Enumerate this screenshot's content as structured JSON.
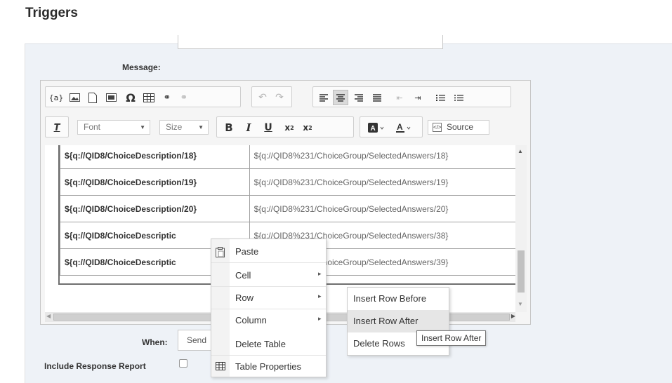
{
  "page": {
    "title": "Triggers"
  },
  "form": {
    "message_label": "Message:",
    "when_label": "When:",
    "when_value": "Send",
    "include_label": "Include Response Report"
  },
  "toolbar": {
    "font_label": "Font",
    "size_label": "Size",
    "source_label": "Source",
    "placeholder_btn": "{a}",
    "bold": "B",
    "italic": "I",
    "underline": "U"
  },
  "table": {
    "rows": [
      {
        "left": "${q://QID8/ChoiceDescription/18}",
        "right": "${q://QID8%231/ChoiceGroup/SelectedAnswers/18}"
      },
      {
        "left": "${q://QID8/ChoiceDescription/19}",
        "right": "${q://QID8%231/ChoiceGroup/SelectedAnswers/19}"
      },
      {
        "left": "${q://QID8/ChoiceDescription/20}",
        "right": "${q://QID8%231/ChoiceGroup/SelectedAnswers/20}"
      },
      {
        "left": "${q://QID8/ChoiceDescriptic",
        "right": "${q://QID8%231/ChoiceGroup/SelectedAnswers/38}"
      },
      {
        "left": "${q://QID8/ChoiceDescriptic",
        "right": "${q://QID8%231/ChoiceGroup/SelectedAnswers/39}"
      }
    ]
  },
  "context_menu": {
    "items": [
      {
        "label": "Paste",
        "icon": "paste-icon"
      },
      {
        "label": "Cell",
        "has_submenu": true
      },
      {
        "label": "Row",
        "has_submenu": true
      },
      {
        "label": "Column",
        "has_submenu": true
      },
      {
        "label": "Delete Table"
      },
      {
        "label": "Table Properties",
        "icon": "table-icon"
      }
    ]
  },
  "row_submenu": {
    "items": [
      {
        "label": "Insert Row Before"
      },
      {
        "label": "Insert Row After"
      },
      {
        "label": "Delete Rows"
      }
    ]
  },
  "tooltip": {
    "text": "Insert Row After"
  },
  "colors": {
    "panel_bg": "#eef2f7",
    "hover_bg": "#e6e6e6"
  }
}
